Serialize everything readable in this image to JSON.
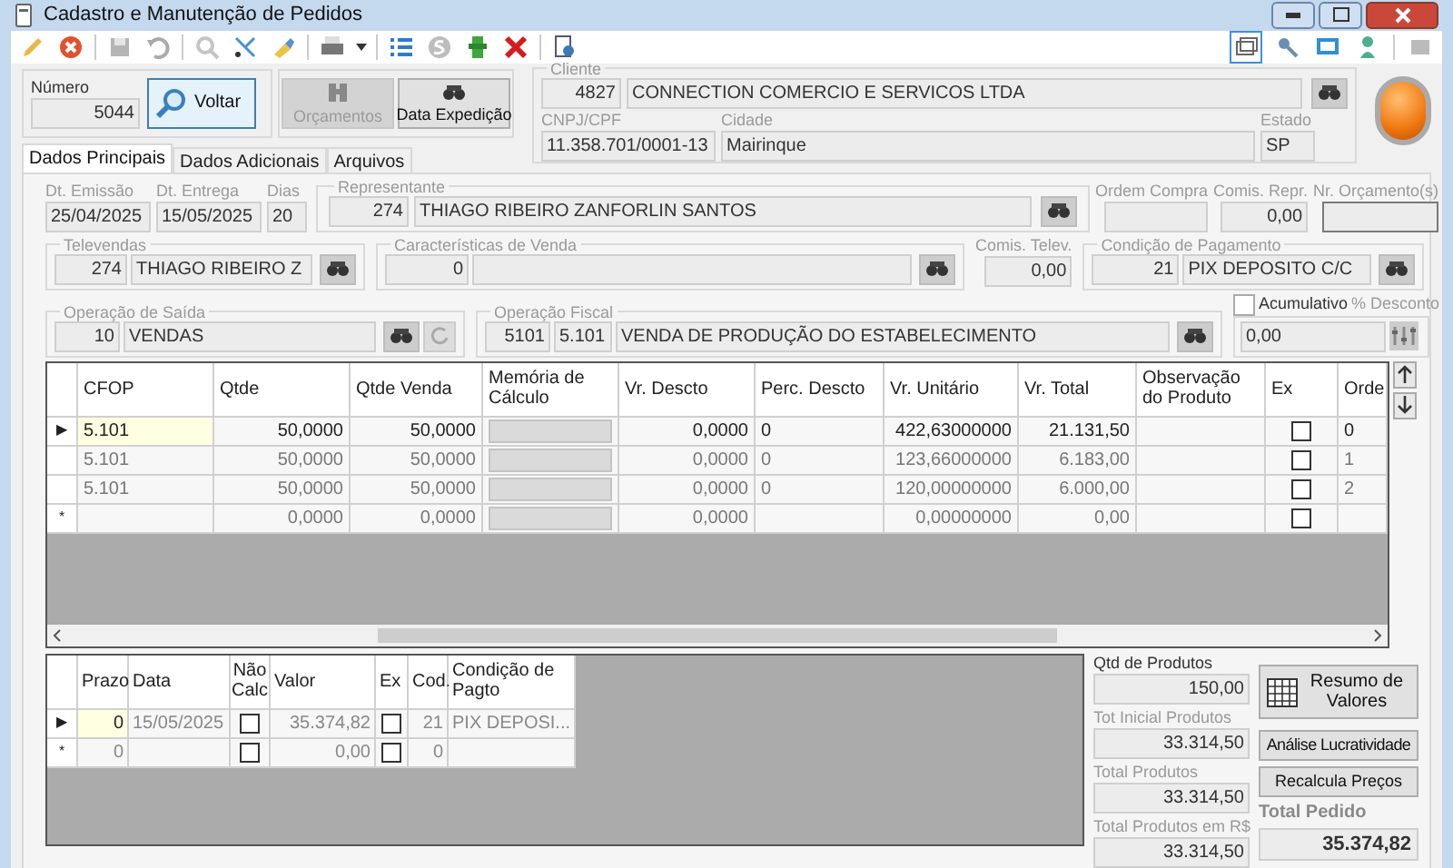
{
  "window": {
    "title": "Cadastro e Manutenção de Pedidos"
  },
  "numero": {
    "label": "Número",
    "value": "5044"
  },
  "voltar_button": {
    "label": "Voltar",
    "disabled": false
  },
  "orcamentos_button": {
    "label": "Orçamentos",
    "disabled": true
  },
  "data_expedicao_button": {
    "label": "Data Expedição",
    "disabled": false
  },
  "cliente": {
    "label": "Cliente",
    "code": "4827",
    "name": "CONNECTION COMERCIO E SERVICOS LTDA"
  },
  "cnpj": {
    "label": "CNPJ/CPF",
    "value": "11.358.701/0001-13"
  },
  "cidade": {
    "label": "Cidade",
    "value": "Mairinque"
  },
  "estado": {
    "label": "Estado",
    "value": "SP"
  },
  "tabs": [
    {
      "label": "Dados Principais",
      "selected": true
    },
    {
      "label": "Dados Adicionais",
      "selected": false
    },
    {
      "label": "Arquivos",
      "selected": false
    }
  ],
  "dt_emissao": {
    "label": "Dt. Emissão",
    "value": "25/04/2025"
  },
  "dt_entrega": {
    "label": "Dt. Entrega",
    "value": "15/05/2025"
  },
  "dias": {
    "label": "Dias",
    "value": "20"
  },
  "representante": {
    "label": "Representante",
    "code": "274",
    "name": "THIAGO RIBEIRO ZANFORLIN SANTOS"
  },
  "ordem_compra": {
    "label": "Ordem Compra"
  },
  "comis_repr": {
    "label": "Comis. Repr.",
    "value": "0,00"
  },
  "nr_orcamento": {
    "label": "Nr. Orçamento(s)"
  },
  "televendas": {
    "label": "Televendas",
    "code": "274",
    "name": "THIAGO RIBEIRO Z"
  },
  "caracteristicas": {
    "label": "Características de Venda",
    "code": "0"
  },
  "comis_telev": {
    "label": "Comis. Telev.",
    "value": "0,00"
  },
  "condicao_pagamento": {
    "label": "Condição de Pagamento",
    "code": "21",
    "name": "PIX DEPOSITO C/C"
  },
  "operacao_saida": {
    "label": "Operação de Saída",
    "code": "10",
    "name": "VENDAS"
  },
  "operacao_fiscal": {
    "label": "Operação Fiscal",
    "code": "5101",
    "cfop": "5.101",
    "name": "VENDA DE PRODUÇÃO DO ESTABELECIMENTO"
  },
  "acumulativo": {
    "label": "Acumulativo",
    "checked": false
  },
  "desconto": {
    "label": "% Desconto",
    "value": "0,00"
  },
  "items_grid": {
    "columns": [
      "CFOP",
      "Qtde",
      "Qtde Venda",
      "Memória de Cálculo",
      "Vr. Descto",
      "Perc. Descto",
      "Vr. Unitário",
      "Vr. Total",
      "Observação do Produto",
      "Ex",
      "Orde"
    ],
    "rows": [
      {
        "indicator": "▶",
        "selected": true,
        "cfop": "5.101",
        "qtde": "50,0000",
        "qtde_venda": "50,0000",
        "vr_descto": "0,0000",
        "perc_descto": "0",
        "vr_unitario": "422,63000000",
        "vr_total": "21.131,50",
        "ex": false,
        "ordem": "0"
      },
      {
        "selected": false,
        "cfop": "5.101",
        "qtde": "50,0000",
        "qtde_venda": "50,0000",
        "vr_descto": "0,0000",
        "perc_descto": "0",
        "vr_unitario": "123,66000000",
        "vr_total": "6.183,00",
        "ex": false,
        "ordem": "1"
      },
      {
        "selected": false,
        "cfop": "5.101",
        "qtde": "50,0000",
        "qtde_venda": "50,0000",
        "vr_descto": "0,0000",
        "perc_descto": "0",
        "vr_unitario": "120,00000000",
        "vr_total": "6.000,00",
        "ex": false,
        "ordem": "2"
      },
      {
        "indicator": "*",
        "selected": false,
        "qtde": "0,0000",
        "qtde_venda": "0,0000",
        "vr_descto": "0,0000",
        "vr_unitario": "0,00000000",
        "vr_total": "0,00",
        "ex": false
      }
    ]
  },
  "installments_grid": {
    "columns": [
      "Prazo",
      "Data",
      "Não Calc",
      "Valor",
      "Ex",
      "Cod.",
      "Condição de Pagto"
    ],
    "rows": [
      {
        "indicator": "▶",
        "selected": true,
        "prazo": "0",
        "data": "15/05/2025",
        "nao_calc": false,
        "valor": "35.374,82",
        "ex": false,
        "cod": "21",
        "condicao": "PIX DEPOSI..."
      },
      {
        "indicator": "*",
        "selected": false,
        "prazo": "0",
        "nao_calc": false,
        "valor": "0,00",
        "ex": false,
        "cod": "0"
      }
    ]
  },
  "qtd_produtos": {
    "label": "Qtd de Produtos",
    "value": "150,00"
  },
  "tot_inicial": {
    "label": "Tot Inicial Produtos",
    "value": "33.314,50"
  },
  "total_produtos": {
    "label": "Total Produtos",
    "value": "33.314,50"
  },
  "total_rs": {
    "label": "Total Produtos em R$",
    "value": "33.314,50"
  },
  "total_pedido": {
    "label": "Total Pedido",
    "value": "35.374,82"
  },
  "resumo_button": {
    "label": "Resumo de Valores"
  },
  "analise_button": {
    "label": "Análise Lucratividade"
  },
  "recalcula_button": {
    "label": "Recalcula Preços"
  }
}
